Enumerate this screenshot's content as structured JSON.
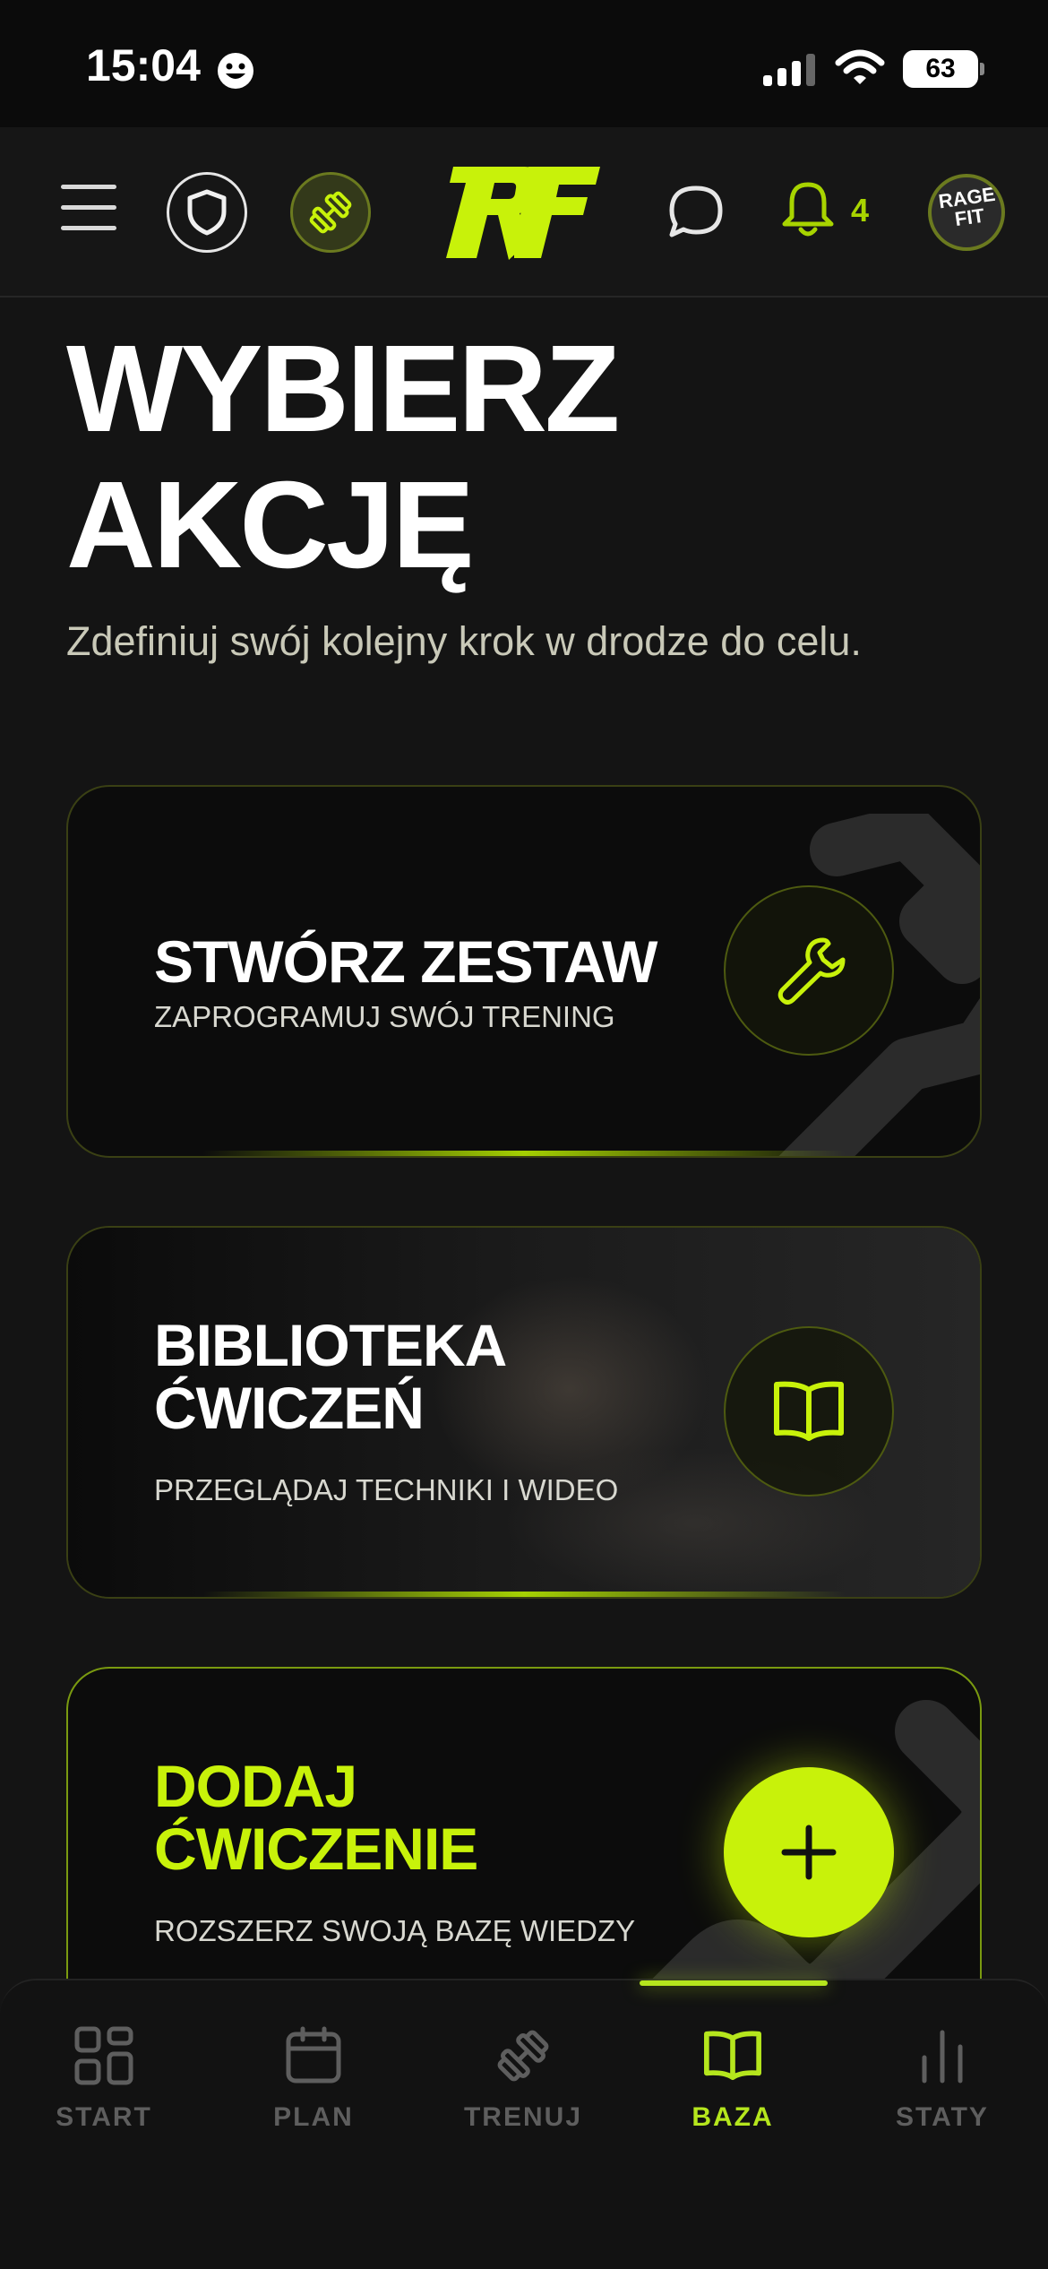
{
  "status_bar": {
    "time": "15:04",
    "battery": "63"
  },
  "header": {
    "notifications_count": "4",
    "avatar_text": "RAGE FIT"
  },
  "main": {
    "title_line1": "WYBIERZ",
    "title_line2": "AKCJĘ",
    "subtitle": "Zdefiniuj swój kolejny krok w drodze do celu."
  },
  "cards": [
    {
      "title": "STWÓRZ ZESTAW",
      "subtitle": "ZAPROGRAMUJ SWÓJ TRENING",
      "icon": "wrench-icon"
    },
    {
      "title_line1": "BIBLIOTEKA",
      "title_line2": "ĆWICZEŃ",
      "subtitle": "PRZEGLĄDAJ TECHNIKI I WIDEO",
      "icon": "book-icon"
    },
    {
      "title_line1": "DODAJ",
      "title_line2": "ĆWICZENIE",
      "subtitle": "ROZSZERZ SWOJĄ BAZĘ WIEDZY",
      "icon": "plus-icon"
    }
  ],
  "tabs": [
    {
      "label": "START",
      "icon": "grid-icon",
      "active": false
    },
    {
      "label": "PLAN",
      "icon": "calendar-icon",
      "active": false
    },
    {
      "label": "TRENUJ",
      "icon": "dumbbell-icon",
      "active": false
    },
    {
      "label": "BAZA",
      "icon": "book-icon",
      "active": true
    },
    {
      "label": "STATY",
      "icon": "bar-chart-icon",
      "active": false
    }
  ],
  "colors": {
    "accent": "#c8f20a",
    "background": "#141414",
    "card": "#0c0c0c"
  }
}
